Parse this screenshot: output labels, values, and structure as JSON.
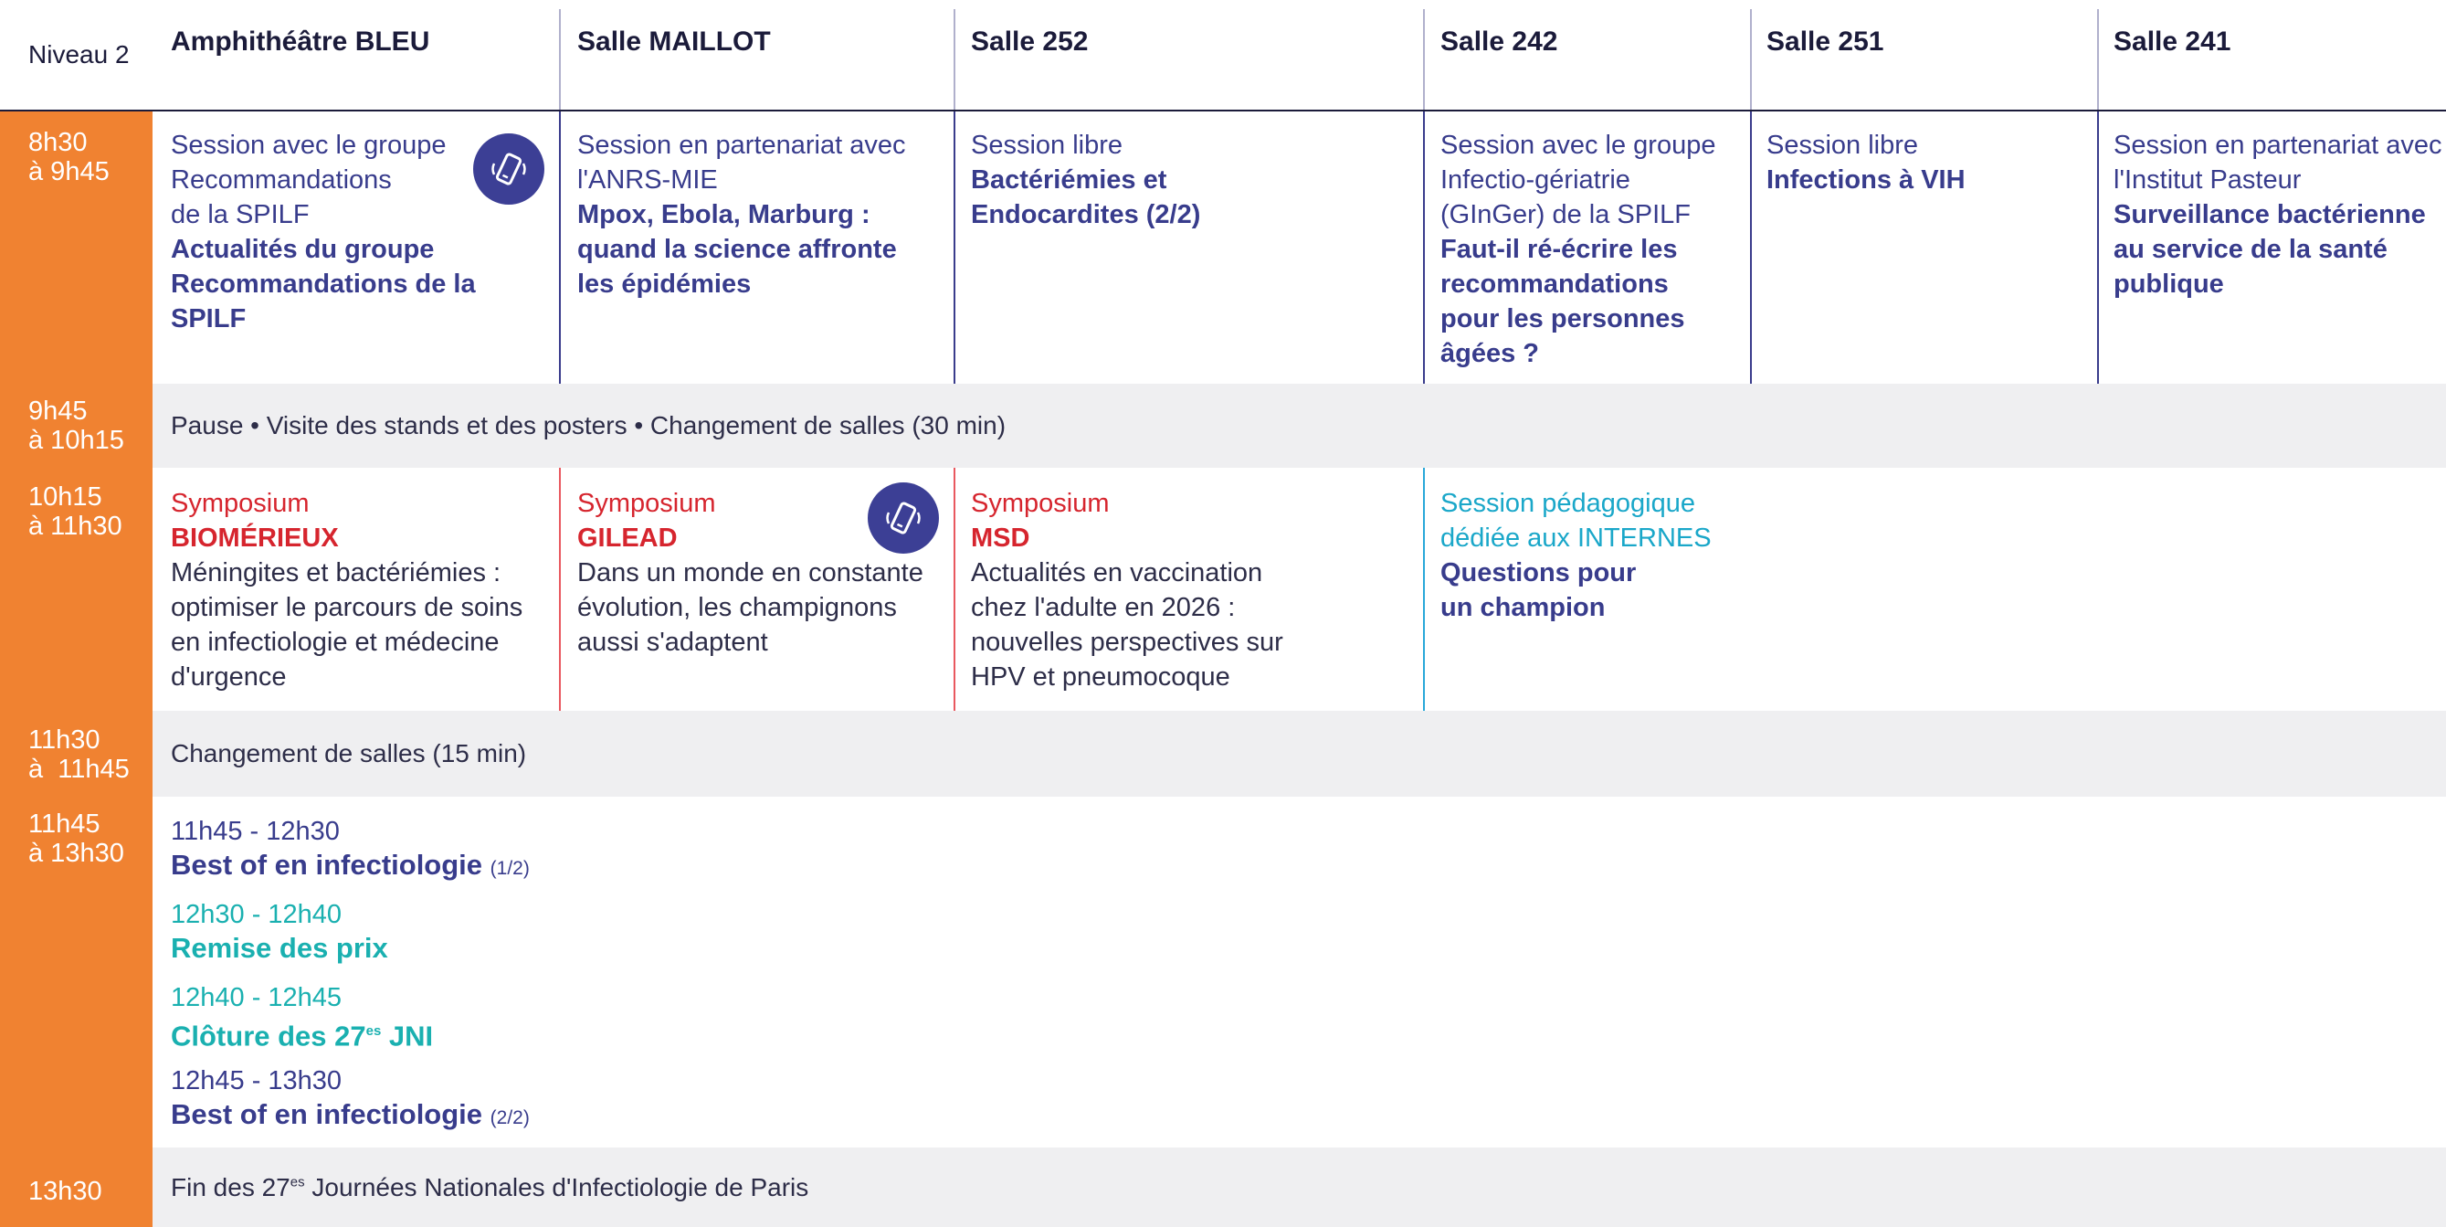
{
  "header": {
    "niveau": "Niveau 2",
    "rooms": [
      "Amphithéâtre BLEU",
      "Salle MAILLOT",
      "Salle 252",
      "Salle 242",
      "Salle 251",
      "Salle 241"
    ]
  },
  "times": {
    "t1": "8h30\nà 9h45",
    "t2": "9h45\nà 10h15",
    "t3": "10h15\nà 11h30",
    "t4": "11h30\nà  11h45",
    "t5": "11h45\nà 13h30",
    "t6": "13h30"
  },
  "row1": {
    "c1": {
      "lite": "Session avec le groupe\nRecommandations\nde la SPILF",
      "bold": "Actualités du groupe\nRecommandations de la\nSPILF"
    },
    "c2": {
      "lite": "Session en partenariat avec\nl'ANRS-MIE",
      "bold": "Mpox, Ebola, Marburg :\nquand la science affronte\nles épidémies"
    },
    "c3": {
      "lite": "Session libre",
      "bold": "Bactériémies et\nEndocardites (2/2)"
    },
    "c4": {
      "lite": "Session avec le groupe\nInfectio-gériatrie\n(GInGer) de la SPILF",
      "bold": "Faut-il ré-écrire les\nrecommandations\npour les personnes\nâgées ?"
    },
    "c5": {
      "lite": "Session libre",
      "bold": "Infections à VIH"
    },
    "c6": {
      "lite": "Session en partenariat avec\nl'Institut Pasteur",
      "bold": "Surveillance bactérienne\nau service de la santé\npublique"
    }
  },
  "band1": "Pause • Visite des stands et des posters • Changement de salles (30 min)",
  "row3": {
    "c1": {
      "lite": "Symposium",
      "bold": "BIOMÉRIEUX",
      "desc": "Méningites et bactériémies :\noptimiser le parcours de soins\nen infectiologie et médecine\nd'urgence"
    },
    "c2": {
      "lite": "Symposium",
      "bold": "GILEAD",
      "desc": "Dans un monde en constante\névolution, les champignons\naussi s'adaptent"
    },
    "c3": {
      "lite": "Symposium",
      "bold": "MSD",
      "desc": "Actualités en vaccination\nchez l'adulte en 2026 :\nnouvelles perspectives sur\nHPV et pneumocoque"
    },
    "c4": {
      "lite": "Session pédagogique\ndédiée aux INTERNES",
      "bold": "Questions pour\nun champion"
    }
  },
  "band2": "Changement de salles (15 min)",
  "row5": {
    "s1": {
      "time": "11h45 - 12h30",
      "name": "Best of en infectiologie",
      "suffix": "(1/2)"
    },
    "s2": {
      "time": "12h30 - 12h40",
      "name": "Remise des prix"
    },
    "s3": {
      "time": "12h40 - 12h45",
      "name_a": "Clôture des 27",
      "sup": "es",
      "name_b": " JNI"
    },
    "s4": {
      "time": "12h45 - 13h30",
      "name": "Best of en infectiologie",
      "suffix": "(2/2)"
    }
  },
  "band3": {
    "a": "Fin des 27",
    "sup": "es",
    "b": " Journées Nationales d'Infectiologie de Paris"
  },
  "colors": {
    "orange": "#f08231",
    "navy": "#383c8c",
    "red": "#d6252e",
    "teal": "#1ab0b0",
    "blue": "#1aa7c9",
    "grey": "#efeff1"
  },
  "icons": [
    "phone-icon"
  ]
}
